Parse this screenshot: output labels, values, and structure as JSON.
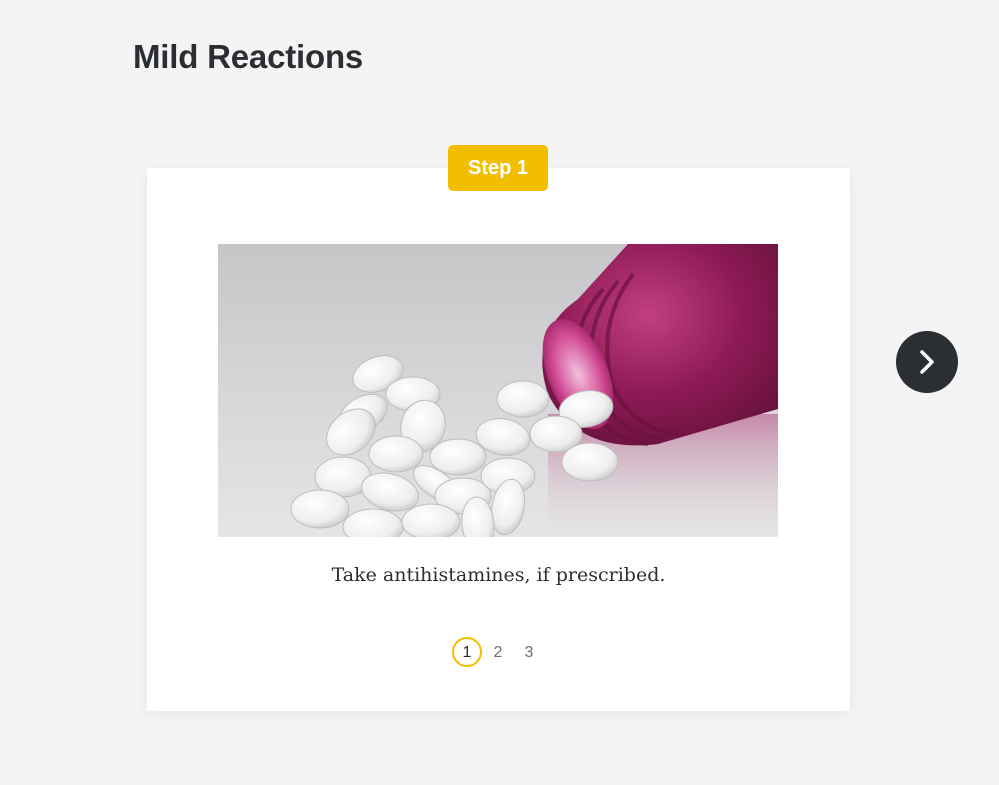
{
  "page": {
    "title": "Mild Reactions"
  },
  "carousel": {
    "step_label": "Step 1",
    "image_alt": "Pills spilling out of a bottle",
    "caption": "Take antihistamines, if prescribed.",
    "pages": [
      "1",
      "2",
      "3"
    ],
    "current_page": 1,
    "next_icon": "chevron-right-icon"
  },
  "colors": {
    "accent": "#f2be00",
    "dark": "#2b2e33",
    "background": "#f4f4f4",
    "card": "#ffffff"
  }
}
